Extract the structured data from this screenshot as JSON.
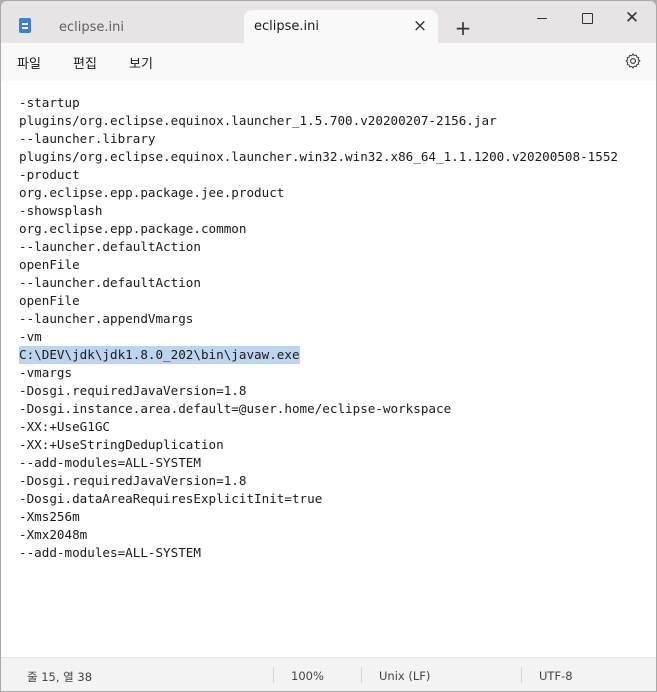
{
  "tabs": {
    "inactive_label": "eclipse.ini",
    "active_label": "eclipse.ini",
    "close_glyph": "×",
    "new_tab_glyph": "+"
  },
  "window_controls": {
    "close_glyph": "✕"
  },
  "menu": {
    "file": "파일",
    "edit": "편집",
    "view": "보기"
  },
  "editor": {
    "lines": [
      "-startup",
      "plugins/org.eclipse.equinox.launcher_1.5.700.v20200207-2156.jar",
      "--launcher.library",
      "plugins/org.eclipse.equinox.launcher.win32.win32.x86_64_1.1.1200.v20200508-1552",
      "-product",
      "org.eclipse.epp.package.jee.product",
      "-showsplash",
      "org.eclipse.epp.package.common",
      "--launcher.defaultAction",
      "openFile",
      "--launcher.defaultAction",
      "openFile",
      "--launcher.appendVmargs",
      "-vm",
      "C:\\DEV\\jdk\\jdk1.8.0_202\\bin\\javaw.exe",
      "-vmargs",
      "-Dosgi.requiredJavaVersion=1.8",
      "-Dosgi.instance.area.default=@user.home/eclipse-workspace",
      "-XX:+UseG1GC",
      "-XX:+UseStringDeduplication",
      "--add-modules=ALL-SYSTEM",
      "-Dosgi.requiredJavaVersion=1.8",
      "-Dosgi.dataAreaRequiresExplicitInit=true",
      "-Xms256m",
      "-Xmx2048m",
      "--add-modules=ALL-SYSTEM"
    ],
    "selected_line_number": 15
  },
  "status": {
    "position": "줄 15, 열 38",
    "zoom": "100%",
    "line_ending": "Unix (LF)",
    "encoding": "UTF-8"
  },
  "colors": {
    "selection": "#bcd4f0",
    "icon_accent": "#3b7fd6"
  }
}
